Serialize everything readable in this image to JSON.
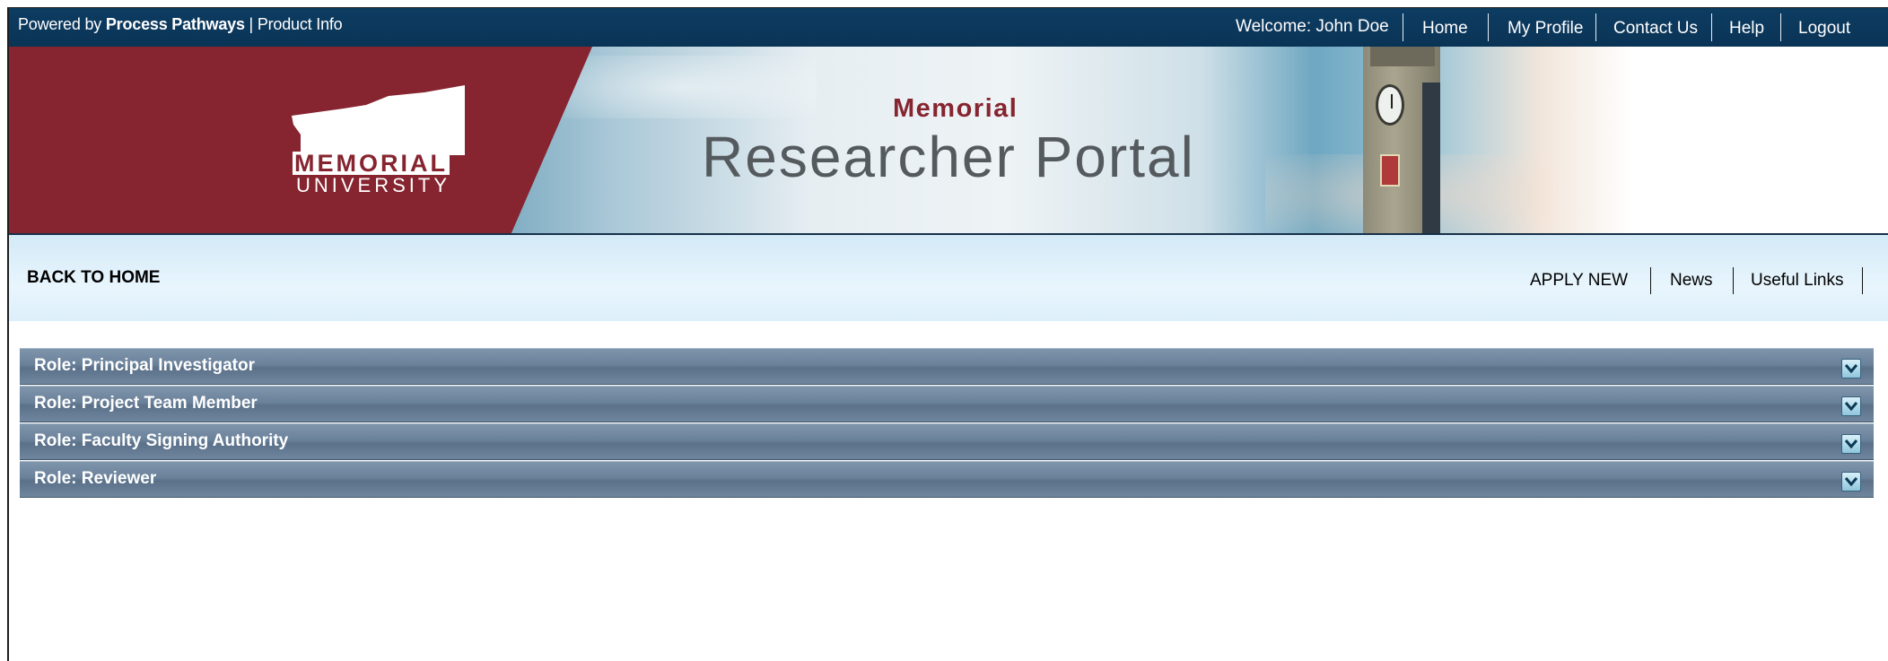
{
  "topbar": {
    "powered_prefix": "Powered by ",
    "powered_brand": "Process Pathways",
    "powered_sep": " | ",
    "product_info": "Product Info",
    "welcome": "Welcome: John Doe",
    "nav": [
      "Home",
      "My Profile",
      "Contact Us",
      "Help",
      "Logout"
    ]
  },
  "banner": {
    "logo_line1": "MEMORIAL",
    "logo_line2": "UNIVERSITY",
    "title_small": "Memorial",
    "title_large": "Researcher Portal"
  },
  "subnav": {
    "back_home": "BACK TO HOME",
    "items": [
      "APPLY NEW",
      "News",
      "Useful Links"
    ]
  },
  "roles": [
    {
      "label": "Role: Principal Investigator",
      "icon": "chevron-down-icon"
    },
    {
      "label": "Role: Project Team Member",
      "icon": "chevron-down-icon"
    },
    {
      "label": "Role: Faculty Signing Authority",
      "icon": "chevron-down-icon"
    },
    {
      "label": "Role: Reviewer",
      "icon": "chevron-down-icon"
    }
  ],
  "colors": {
    "topbar": "#0d3c62",
    "brand_red": "#86242f",
    "role_bar": "#6a819a",
    "subnav_bg": "#e1f1fb"
  }
}
